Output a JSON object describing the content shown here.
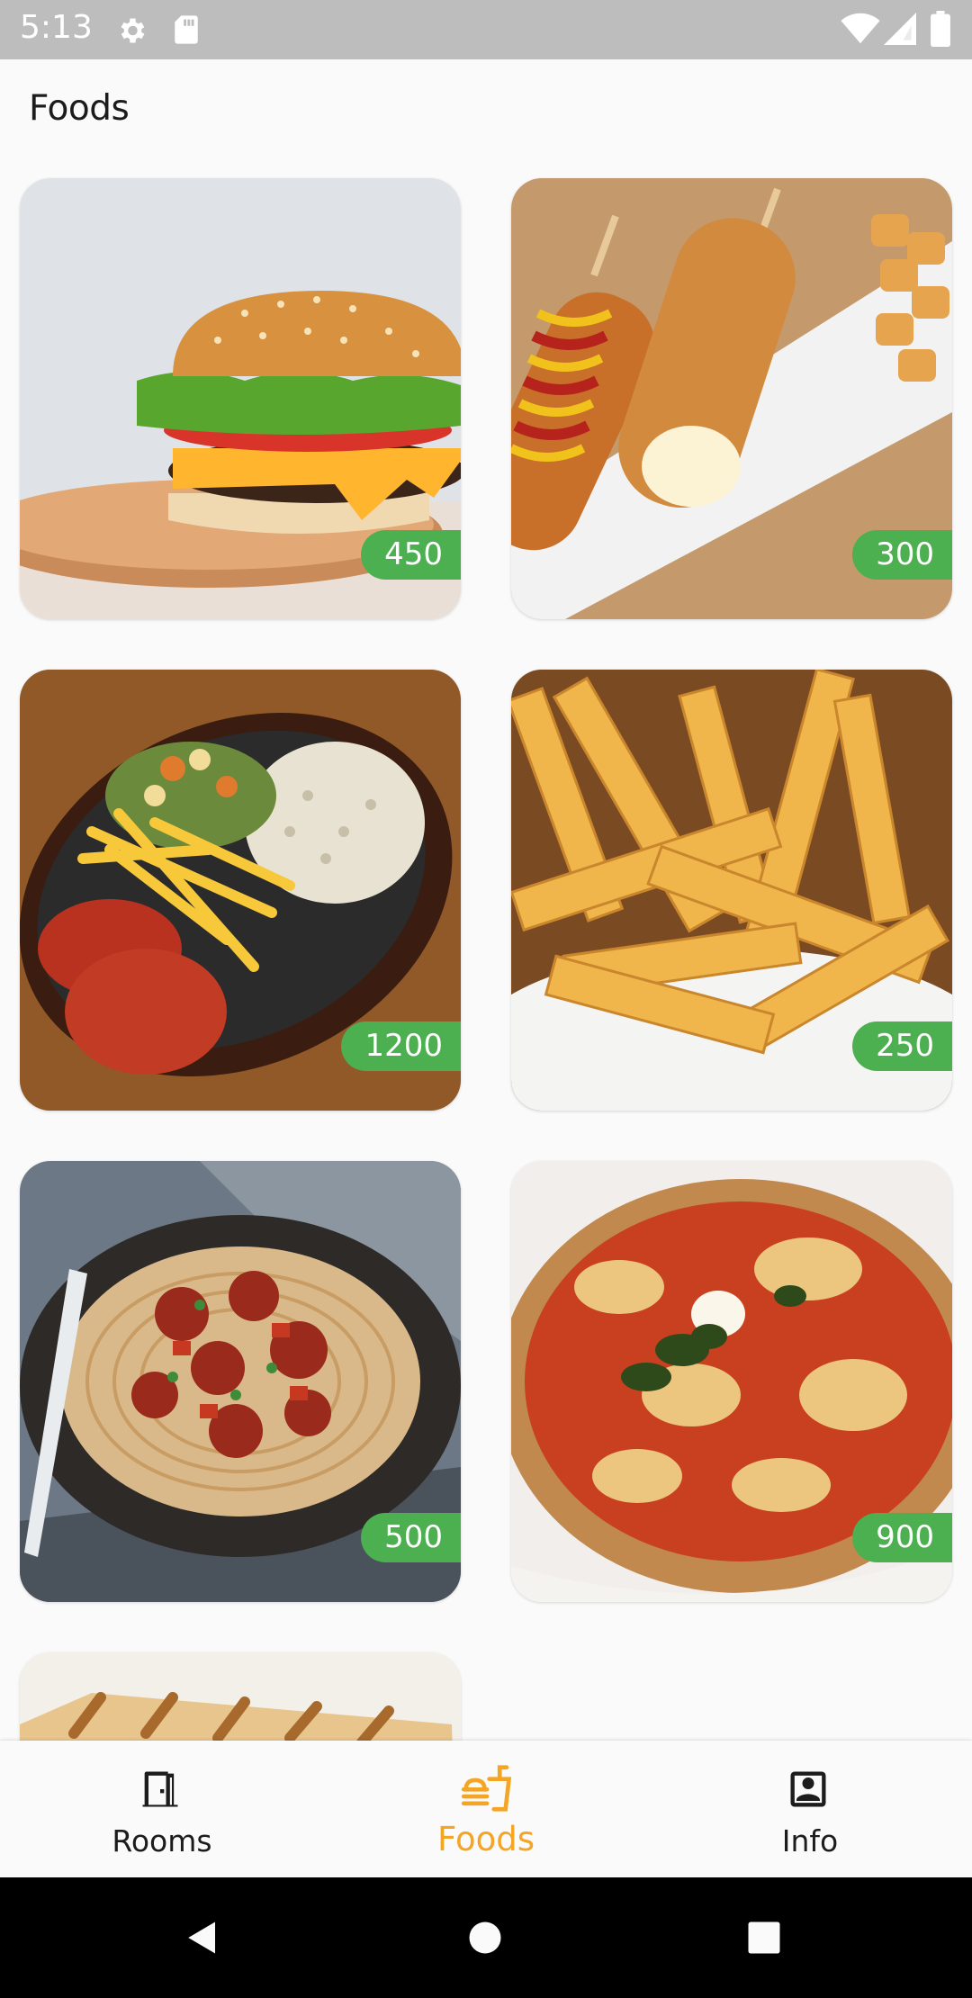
{
  "status_bar": {
    "time": "5:13",
    "left_icons": [
      "gear-icon",
      "sd-card-icon"
    ],
    "right_icons": [
      "wifi-icon",
      "signal-icon",
      "battery-icon"
    ]
  },
  "app": {
    "title": "Foods"
  },
  "foods": [
    {
      "name": "burger",
      "price": "450"
    },
    {
      "name": "corn-dogs",
      "price": "300"
    },
    {
      "name": "sizzler-platter",
      "price": "1200"
    },
    {
      "name": "french-fries",
      "price": "250"
    },
    {
      "name": "spaghetti-meatballs",
      "price": "500"
    },
    {
      "name": "pizza",
      "price": "900"
    },
    {
      "name": "grilled-sandwich",
      "price": ""
    }
  ],
  "bottom_nav": {
    "active": "Foods",
    "active_color": "#f5a524",
    "items": [
      {
        "label": "Rooms",
        "icon": "door-icon"
      },
      {
        "label": "Foods",
        "icon": "fastfood-icon"
      },
      {
        "label": "Info",
        "icon": "contact-card-icon"
      }
    ]
  },
  "colors": {
    "price_badge": "#4caf50",
    "status_bar": "#bdbdbd"
  }
}
